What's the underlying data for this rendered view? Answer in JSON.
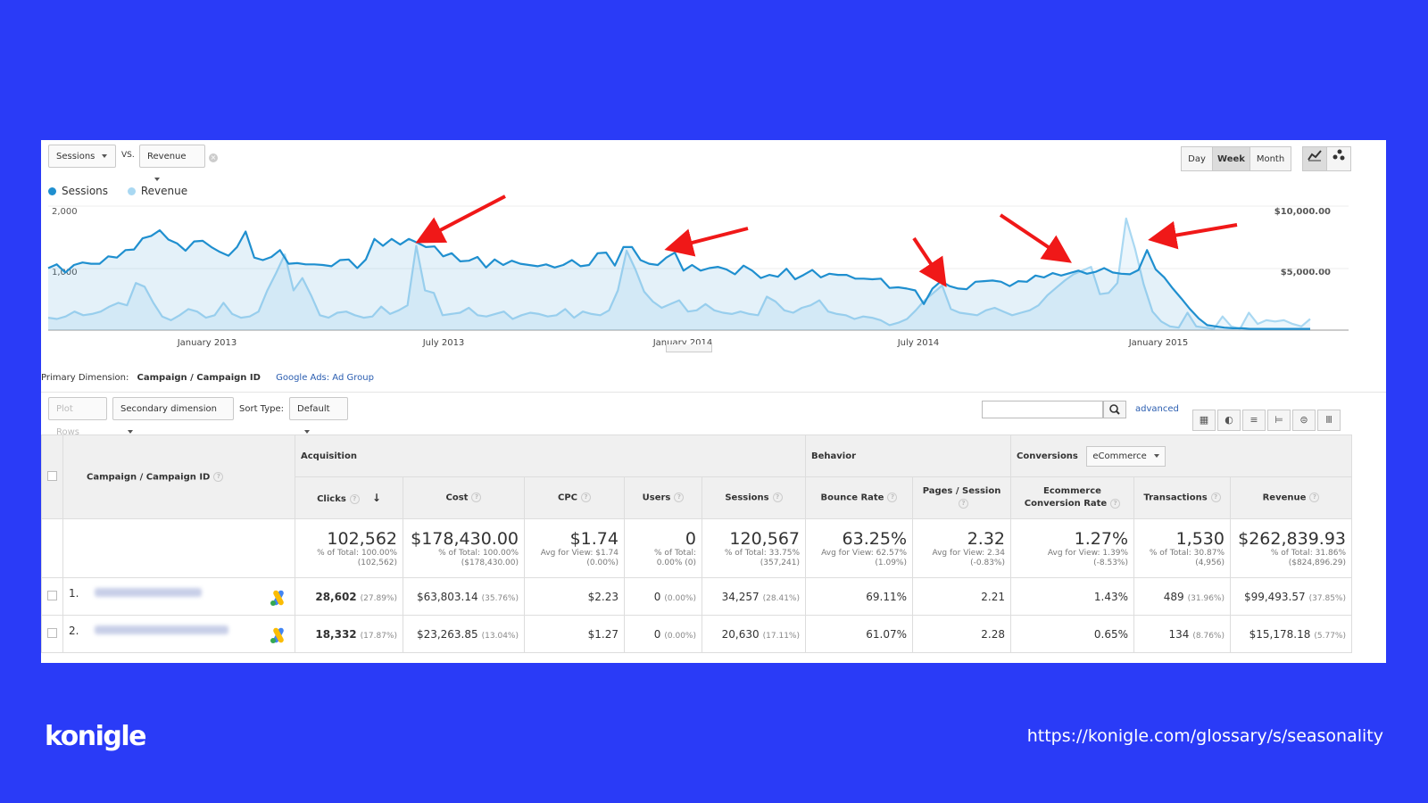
{
  "brand": "konigle",
  "source_url": "https://konigle.com/glossary/s/seasonality",
  "chart_controls": {
    "metric1": "Sessions",
    "vs": "VS.",
    "metric2": "Revenue",
    "ranges": [
      "Day",
      "Week",
      "Month"
    ],
    "active_range": "Week"
  },
  "colors": {
    "page_bg": "#2a3bf7",
    "sessions": "#1f8fcf",
    "revenue": "#a9d8f2",
    "arrow": "#f01818",
    "link": "#2a5db0"
  },
  "chart_data": {
    "type": "line",
    "legend": [
      "Sessions",
      "Revenue"
    ],
    "y_left_ticks": [
      "2,000",
      "1,000"
    ],
    "y_right_ticks": [
      "$10,000.00",
      "$5,000.00"
    ],
    "x_tick_labels": [
      "January 2013",
      "July 2013",
      "January 2014",
      "July 2014",
      "January 2015"
    ],
    "left_axis_max": 2000,
    "right_axis_max": 10000,
    "series": [
      {
        "name": "Sessions",
        "axis": "left",
        "values": [
          1000,
          1060,
          930,
          1050,
          1090,
          1070,
          1070,
          1190,
          1170,
          1290,
          1300,
          1480,
          1520,
          1610,
          1460,
          1400,
          1280,
          1430,
          1440,
          1340,
          1260,
          1200,
          1340,
          1590,
          1170,
          1130,
          1180,
          1290,
          1070,
          1080,
          1060,
          1060,
          1050,
          1030,
          1130,
          1140,
          1000,
          1140,
          1470,
          1360,
          1470,
          1380,
          1470,
          1410,
          1340,
          1350,
          1190,
          1240,
          1110,
          1120,
          1180,
          1010,
          1140,
          1050,
          1120,
          1070,
          1050,
          1030,
          1060,
          1010,
          1050,
          1130,
          1030,
          1050,
          1240,
          1250,
          1040,
          1340,
          1340,
          1130,
          1070,
          1050,
          1170,
          1250,
          960,
          1050,
          960,
          1000,
          1020,
          980,
          900,
          1040,
          960,
          840,
          890,
          860,
          990,
          820,
          890,
          970,
          850,
          910,
          890,
          890,
          830,
          830,
          820,
          830,
          680,
          690,
          670,
          640,
          420,
          670,
          790,
          710,
          670,
          660,
          780,
          790,
          800,
          780,
          710,
          790,
          780,
          880,
          850,
          920,
          880,
          920,
          960,
          910,
          940,
          1000,
          930,
          910,
          900,
          970,
          1290,
          980,
          850,
          670,
          510,
          340,
          190,
          80,
          60,
          40,
          30,
          30,
          20,
          20,
          20,
          20,
          20,
          20,
          20,
          20
        ]
      },
      {
        "name": "Revenue",
        "axis": "right",
        "values": [
          1000,
          900,
          1100,
          1500,
          1200,
          1300,
          1500,
          1900,
          2200,
          2000,
          3800,
          3500,
          2200,
          1100,
          800,
          1200,
          1700,
          1500,
          1000,
          1200,
          2200,
          1300,
          1000,
          1100,
          1500,
          3200,
          4600,
          6100,
          3200,
          4200,
          2800,
          1200,
          1000,
          1400,
          1500,
          1200,
          1000,
          1100,
          1900,
          1300,
          1600,
          2000,
          6800,
          3200,
          3000,
          1200,
          1300,
          1400,
          1800,
          1200,
          1100,
          1300,
          1500,
          900,
          1200,
          1400,
          1300,
          1100,
          1200,
          1700,
          1000,
          1500,
          1300,
          1200,
          1600,
          3200,
          6400,
          4900,
          3100,
          2300,
          1800,
          2100,
          2400,
          1500,
          1600,
          2100,
          1600,
          1400,
          1300,
          1500,
          1300,
          1200,
          2700,
          2300,
          1600,
          1400,
          1800,
          2000,
          2400,
          1500,
          1300,
          1200,
          900,
          1100,
          1000,
          800,
          400,
          600,
          900,
          1600,
          2400,
          3000,
          3600,
          1700,
          1400,
          1300,
          1200,
          1600,
          1800,
          1500,
          1200,
          1400,
          1600,
          2000,
          2800,
          3400,
          4000,
          4500,
          4800,
          5100,
          2900,
          3000,
          3800,
          9000,
          6600,
          3700,
          1500,
          700,
          300,
          200,
          1400,
          300,
          200,
          100,
          1100,
          300,
          100,
          1400,
          500,
          800,
          700,
          800,
          500,
          300,
          900
        ]
      }
    ]
  },
  "table_controls": {
    "primary_dimension_label": "Primary Dimension:",
    "primary_dimension": "Campaign / Campaign ID",
    "alt_dimension": "Google Ads: Ad Group",
    "plot_rows": "Plot Rows",
    "secondary_dimension": "Secondary dimension",
    "sort_type_label": "Sort Type:",
    "sort_type": "Default",
    "search_placeholder": "",
    "advanced": "advanced"
  },
  "table": {
    "dimension_header": "Campaign / Campaign ID",
    "groups": {
      "acquisition": "Acquisition",
      "behavior": "Behavior",
      "conversions": "Conversions",
      "conversions_select": "eCommerce"
    },
    "columns": [
      "Clicks",
      "Cost",
      "CPC",
      "Users",
      "Sessions",
      "Bounce Rate",
      "Pages / Session",
      "Ecommerce Conversion Rate",
      "Transactions",
      "Revenue"
    ],
    "totals": [
      {
        "value": "102,562",
        "sub": "% of Total: 100.00% (102,562)"
      },
      {
        "value": "$178,430.00",
        "sub": "% of Total: 100.00% ($178,430.00)"
      },
      {
        "value": "$1.74",
        "sub": "Avg for View: $1.74 (0.00%)"
      },
      {
        "value": "0",
        "sub": "% of Total: 0.00% (0)"
      },
      {
        "value": "120,567",
        "sub": "% of Total: 33.75% (357,241)"
      },
      {
        "value": "63.25%",
        "sub": "Avg for View: 62.57% (1.09%)"
      },
      {
        "value": "2.32",
        "sub": "Avg for View: 2.34 (-0.83%)"
      },
      {
        "value": "1.27%",
        "sub": "Avg for View: 1.39% (-8.53%)"
      },
      {
        "value": "1,530",
        "sub": "% of Total: 30.87% (4,956)"
      },
      {
        "value": "$262,839.93",
        "sub": "% of Total: 31.86% ($824,896.29)"
      }
    ],
    "rows": [
      {
        "index": "1.",
        "clicks": "28,602",
        "clicks_pct": "(27.89%)",
        "cost": "$63,803.14",
        "cost_pct": "(35.76%)",
        "cpc": "$2.23",
        "users": "0",
        "users_pct": "(0.00%)",
        "sessions": "34,257",
        "sessions_pct": "(28.41%)",
        "bounce": "69.11%",
        "pages": "2.21",
        "conv": "1.43%",
        "transactions": "489",
        "transactions_pct": "(31.96%)",
        "revenue": "$99,493.57",
        "revenue_pct": "(37.85%)"
      },
      {
        "index": "2.",
        "clicks": "18,332",
        "clicks_pct": "(17.87%)",
        "cost": "$23,263.85",
        "cost_pct": "(13.04%)",
        "cpc": "$1.27",
        "users": "0",
        "users_pct": "(0.00%)",
        "sessions": "20,630",
        "sessions_pct": "(17.11%)",
        "bounce": "61.07%",
        "pages": "2.28",
        "conv": "0.65%",
        "transactions": "134",
        "transactions_pct": "(8.76%)",
        "revenue": "$15,178.18",
        "revenue_pct": "(5.77%)"
      }
    ]
  }
}
